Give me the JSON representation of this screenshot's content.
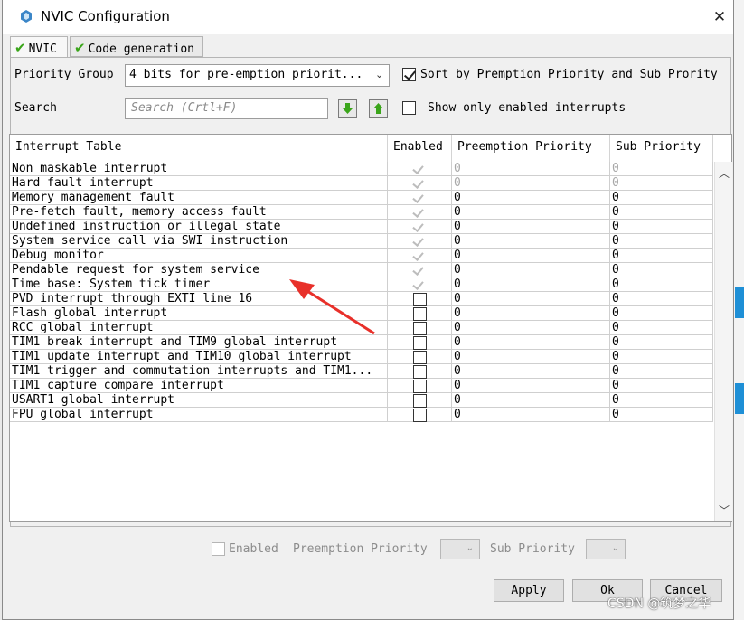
{
  "window": {
    "title": "NVIC Configuration",
    "close_glyph": "✕",
    "icon": "cube-logo-icon",
    "accent": "#1e8fd6"
  },
  "tabs": [
    {
      "label": "NVIC",
      "active": true,
      "icon": "check-icon"
    },
    {
      "label": "Code generation",
      "active": false,
      "icon": "check-icon"
    }
  ],
  "priority_group": {
    "label": "Priority Group",
    "value": "4 bits for pre-emption priorit..."
  },
  "sort": {
    "label": "Sort by Premption Priority and Sub Prority",
    "checked": true
  },
  "search": {
    "label": "Search",
    "placeholder": "Search (Crtl+F)"
  },
  "show_enabled": {
    "label": "Show only enabled interrupts",
    "checked": false
  },
  "table": {
    "headers": [
      "Interrupt Table",
      "Enabled",
      "Preemption Priority",
      "Sub Priority"
    ],
    "rows": [
      {
        "name": "Non maskable interrupt",
        "enabled": true,
        "locked": true,
        "pre": "0",
        "sub": "0",
        "pre_grey": true,
        "sub_grey": true
      },
      {
        "name": "Hard fault interrupt",
        "enabled": true,
        "locked": true,
        "pre": "0",
        "sub": "0",
        "pre_grey": true,
        "sub_grey": true
      },
      {
        "name": "Memory management fault",
        "enabled": true,
        "locked": true,
        "pre": "0",
        "sub": "0",
        "pre_grey": false,
        "sub_grey": false
      },
      {
        "name": "Pre-fetch fault, memory access fault",
        "enabled": true,
        "locked": true,
        "pre": "0",
        "sub": "0",
        "pre_grey": false,
        "sub_grey": false
      },
      {
        "name": "Undefined instruction or illegal state",
        "enabled": true,
        "locked": true,
        "pre": "0",
        "sub": "0",
        "pre_grey": false,
        "sub_grey": false
      },
      {
        "name": "System service call via SWI instruction",
        "enabled": true,
        "locked": true,
        "pre": "0",
        "sub": "0",
        "pre_grey": false,
        "sub_grey": false
      },
      {
        "name": "Debug monitor",
        "enabled": true,
        "locked": true,
        "pre": "0",
        "sub": "0",
        "pre_grey": false,
        "sub_grey": false
      },
      {
        "name": "Pendable request for system service",
        "enabled": true,
        "locked": true,
        "pre": "0",
        "sub": "0",
        "pre_grey": false,
        "sub_grey": false
      },
      {
        "name": "Time base: System tick timer",
        "enabled": true,
        "locked": true,
        "pre": "0",
        "sub": "0",
        "pre_grey": false,
        "sub_grey": false
      },
      {
        "name": "PVD interrupt through EXTI line 16",
        "enabled": false,
        "locked": false,
        "pre": "0",
        "sub": "0",
        "pre_grey": false,
        "sub_grey": false
      },
      {
        "name": "Flash global interrupt",
        "enabled": false,
        "locked": false,
        "pre": "0",
        "sub": "0",
        "pre_grey": false,
        "sub_grey": false
      },
      {
        "name": "RCC global interrupt",
        "enabled": false,
        "locked": false,
        "pre": "0",
        "sub": "0",
        "pre_grey": false,
        "sub_grey": false
      },
      {
        "name": "TIM1 break interrupt and TIM9 global interrupt",
        "enabled": false,
        "locked": false,
        "pre": "0",
        "sub": "0",
        "pre_grey": false,
        "sub_grey": false
      },
      {
        "name": "TIM1 update interrupt and TIM10 global interrupt",
        "enabled": false,
        "locked": false,
        "pre": "0",
        "sub": "0",
        "pre_grey": false,
        "sub_grey": false
      },
      {
        "name": "TIM1 trigger and commutation interrupts and TIM1...",
        "enabled": false,
        "locked": false,
        "pre": "0",
        "sub": "0",
        "pre_grey": false,
        "sub_grey": false
      },
      {
        "name": "TIM1 capture compare interrupt",
        "enabled": false,
        "locked": false,
        "pre": "0",
        "sub": "0",
        "pre_grey": false,
        "sub_grey": false
      },
      {
        "name": "USART1 global interrupt",
        "enabled": false,
        "locked": false,
        "pre": "0",
        "sub": "0",
        "pre_grey": false,
        "sub_grey": false
      },
      {
        "name": "FPU global interrupt",
        "enabled": false,
        "locked": false,
        "pre": "0",
        "sub": "0",
        "pre_grey": false,
        "sub_grey": false
      }
    ]
  },
  "detail": {
    "enabled_label": "Enabled",
    "preemption_label": "Preemption Priority",
    "sub_label": "Sub Priority"
  },
  "buttons": {
    "apply": "Apply",
    "ok": "Ok",
    "cancel": "Cancel"
  },
  "annotation": {
    "color": "#e8302a"
  },
  "watermark": "CSDN @筑梦之华"
}
